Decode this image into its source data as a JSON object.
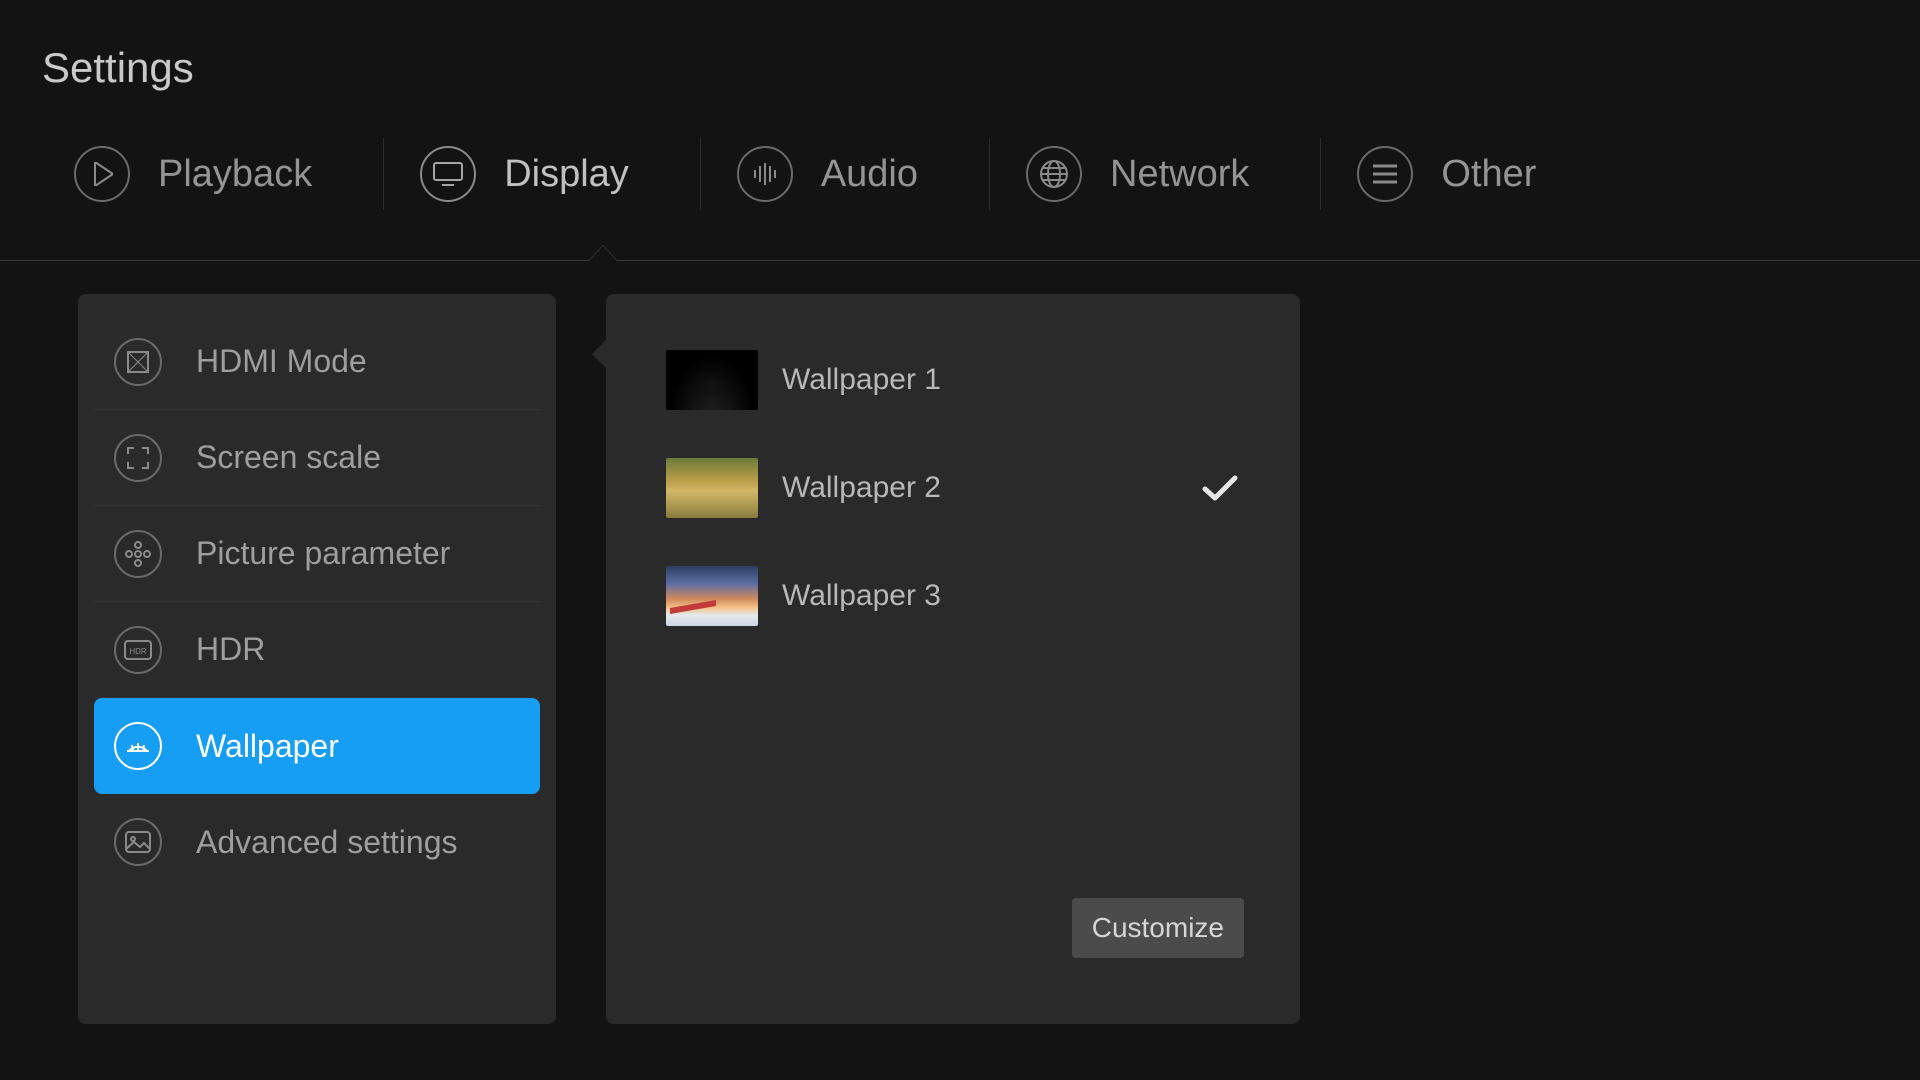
{
  "page_title": "Settings",
  "tabs": {
    "playback": "Playback",
    "display": "Display",
    "audio": "Audio",
    "network": "Network",
    "other": "Other",
    "active": "display"
  },
  "sidebar": {
    "items": [
      {
        "key": "hdmi",
        "label": "HDMI Mode"
      },
      {
        "key": "scale",
        "label": "Screen scale"
      },
      {
        "key": "picture",
        "label": "Picture parameter"
      },
      {
        "key": "hdr",
        "label": "HDR"
      },
      {
        "key": "wallpaper",
        "label": "Wallpaper"
      },
      {
        "key": "advanced",
        "label": "Advanced settings"
      }
    ],
    "selected": "wallpaper"
  },
  "wallpapers": {
    "items": [
      {
        "label": "Wallpaper 1",
        "selected": false
      },
      {
        "label": "Wallpaper 2",
        "selected": true
      },
      {
        "label": "Wallpaper 3",
        "selected": false
      }
    ],
    "customize_label": "Customize"
  },
  "colors": {
    "accent": "#169ef4"
  }
}
